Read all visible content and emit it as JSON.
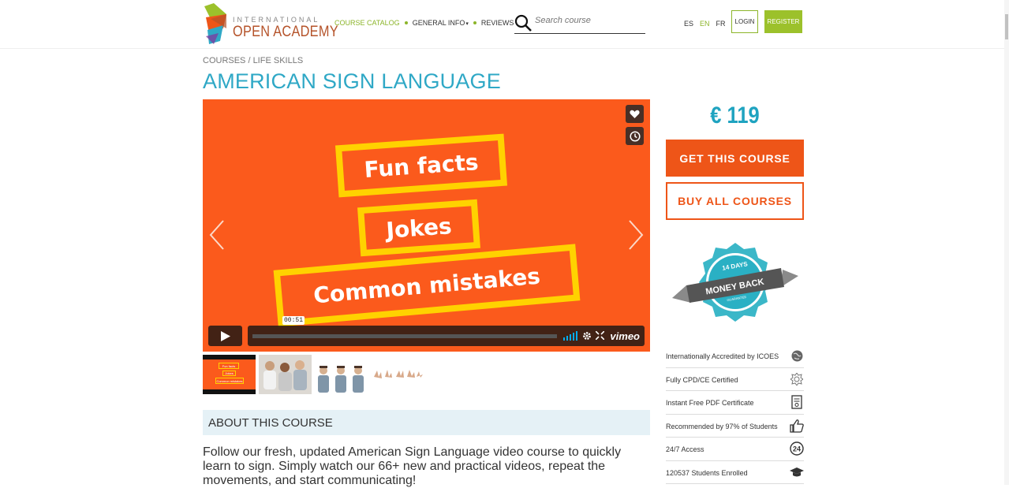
{
  "header": {
    "logo": {
      "top": "INTERNATIONAL",
      "bottom": "OPEN ACADEMY"
    },
    "nav": [
      {
        "label": "COURSE CATALOG",
        "active": true
      },
      {
        "label": "GENERAL INFO",
        "active": false
      },
      {
        "label": "REVIEWS",
        "active": false
      }
    ],
    "search": {
      "placeholder": "Search course",
      "value": ""
    },
    "languages": [
      {
        "code": "ES",
        "active": false
      },
      {
        "code": "EN",
        "active": true
      },
      {
        "code": "FR",
        "active": false
      }
    ],
    "login_label": "LOGIN",
    "register_label": "REGISTER"
  },
  "breadcrumb": "COURSES / LIFE SKILLS",
  "course": {
    "title": "AMERICAN SIGN LANGUAGE",
    "price": "€ 119",
    "get_label": "GET THIS COURSE",
    "buy_all_label": "BUY ALL COURSES"
  },
  "video": {
    "slide_lines": [
      "Fun facts",
      "Jokes",
      "Common mistakes"
    ],
    "timecode": "00:51",
    "player_brand": "vimeo"
  },
  "thumbnails": [
    {
      "name": "slide-thumbnail",
      "lines": [
        "Fun facts",
        "Jokes",
        "Common mistakes"
      ]
    },
    {
      "name": "students-thumbnail"
    },
    {
      "name": "sign-demo-thumbnail"
    },
    {
      "name": "hand-signs-thumbnail"
    }
  ],
  "badge": {
    "line1": "14 DAYS",
    "line2": "MONEY BACK",
    "line3": "GUARANTEE"
  },
  "features": [
    {
      "label": "Internationally Accredited by ICOES",
      "icon": "globe-icon"
    },
    {
      "label": "Fully CPD/CE Certified",
      "icon": "seal-icon"
    },
    {
      "label": "Instant Free PDF Certificate",
      "icon": "certificate-icon"
    },
    {
      "label": "Recommended by 97% of Students",
      "icon": "thumbs-up-icon"
    },
    {
      "label": "24/7 Access",
      "icon": "clock-24-icon"
    },
    {
      "label": "120537 Students Enrolled",
      "icon": "graduation-cap-icon"
    }
  ],
  "about": {
    "title": "ABOUT THIS COURSE",
    "text": "Follow our fresh, updated American Sign Language video course to quickly learn to sign. Simply watch our 66+ new and practical videos, repeat the movements, and start communicating!"
  },
  "colors": {
    "brand_green": "#9cc12b",
    "title_blue": "#2fa8c6",
    "cta_orange": "#ee5518",
    "video_orange": "#fb5a1c",
    "slide_yellow": "#ffd200"
  }
}
